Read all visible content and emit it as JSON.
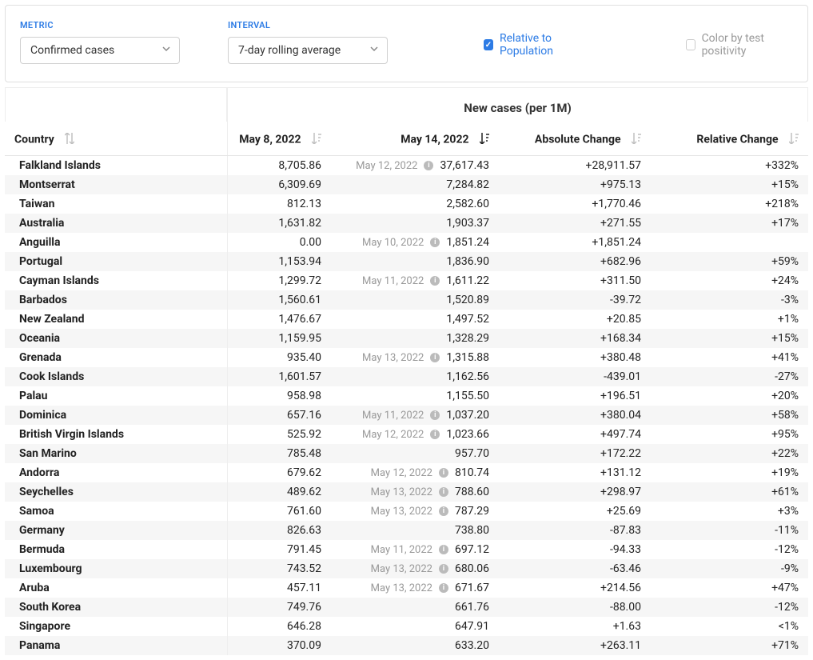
{
  "controls": {
    "metric_label": "METRIC",
    "metric_value": "Confirmed cases",
    "interval_label": "INTERVAL",
    "interval_value": "7-day rolling average",
    "relative_label": "Relative to Population",
    "relative_checked": true,
    "color_label": "Color by test positivity",
    "color_checked": false
  },
  "table": {
    "title": "New cases (per 1M)",
    "headers": {
      "country": "Country",
      "may8": "May 8, 2022",
      "may14": "May 14, 2022",
      "abs": "Absolute Change",
      "rel": "Relative Change"
    },
    "rows": [
      {
        "country": "Falkland Islands",
        "may8": "8,705.86",
        "may14": "37,617.43",
        "note_date": "May 12, 2022",
        "abs": "+28,911.57",
        "rel": "+332%"
      },
      {
        "country": "Montserrat",
        "may8": "6,309.69",
        "may14": "7,284.82",
        "note_date": null,
        "abs": "+975.13",
        "rel": "+15%"
      },
      {
        "country": "Taiwan",
        "may8": "812.13",
        "may14": "2,582.60",
        "note_date": null,
        "abs": "+1,770.46",
        "rel": "+218%"
      },
      {
        "country": "Australia",
        "may8": "1,631.82",
        "may14": "1,903.37",
        "note_date": null,
        "abs": "+271.55",
        "rel": "+17%"
      },
      {
        "country": "Anguilla",
        "may8": "0.00",
        "may14": "1,851.24",
        "note_date": "May 10, 2022",
        "abs": "+1,851.24",
        "rel": ""
      },
      {
        "country": "Portugal",
        "may8": "1,153.94",
        "may14": "1,836.90",
        "note_date": null,
        "abs": "+682.96",
        "rel": "+59%"
      },
      {
        "country": "Cayman Islands",
        "may8": "1,299.72",
        "may14": "1,611.22",
        "note_date": "May 11, 2022",
        "abs": "+311.50",
        "rel": "+24%"
      },
      {
        "country": "Barbados",
        "may8": "1,560.61",
        "may14": "1,520.89",
        "note_date": null,
        "abs": "-39.72",
        "rel": "-3%"
      },
      {
        "country": "New Zealand",
        "may8": "1,476.67",
        "may14": "1,497.52",
        "note_date": null,
        "abs": "+20.85",
        "rel": "+1%"
      },
      {
        "country": "Oceania",
        "may8": "1,159.95",
        "may14": "1,328.29",
        "note_date": null,
        "abs": "+168.34",
        "rel": "+15%"
      },
      {
        "country": "Grenada",
        "may8": "935.40",
        "may14": "1,315.88",
        "note_date": "May 13, 2022",
        "abs": "+380.48",
        "rel": "+41%"
      },
      {
        "country": "Cook Islands",
        "may8": "1,601.57",
        "may14": "1,162.56",
        "note_date": null,
        "abs": "-439.01",
        "rel": "-27%"
      },
      {
        "country": "Palau",
        "may8": "958.98",
        "may14": "1,155.50",
        "note_date": null,
        "abs": "+196.51",
        "rel": "+20%"
      },
      {
        "country": "Dominica",
        "may8": "657.16",
        "may14": "1,037.20",
        "note_date": "May 11, 2022",
        "abs": "+380.04",
        "rel": "+58%"
      },
      {
        "country": "British Virgin Islands",
        "may8": "525.92",
        "may14": "1,023.66",
        "note_date": "May 12, 2022",
        "abs": "+497.74",
        "rel": "+95%"
      },
      {
        "country": "San Marino",
        "may8": "785.48",
        "may14": "957.70",
        "note_date": null,
        "abs": "+172.22",
        "rel": "+22%"
      },
      {
        "country": "Andorra",
        "may8": "679.62",
        "may14": "810.74",
        "note_date": "May 12, 2022",
        "abs": "+131.12",
        "rel": "+19%"
      },
      {
        "country": "Seychelles",
        "may8": "489.62",
        "may14": "788.60",
        "note_date": "May 13, 2022",
        "abs": "+298.97",
        "rel": "+61%"
      },
      {
        "country": "Samoa",
        "may8": "761.60",
        "may14": "787.29",
        "note_date": "May 13, 2022",
        "abs": "+25.69",
        "rel": "+3%"
      },
      {
        "country": "Germany",
        "may8": "826.63",
        "may14": "738.80",
        "note_date": null,
        "abs": "-87.83",
        "rel": "-11%"
      },
      {
        "country": "Bermuda",
        "may8": "791.45",
        "may14": "697.12",
        "note_date": "May 11, 2022",
        "abs": "-94.33",
        "rel": "-12%"
      },
      {
        "country": "Luxembourg",
        "may8": "743.52",
        "may14": "680.06",
        "note_date": "May 13, 2022",
        "abs": "-63.46",
        "rel": "-9%"
      },
      {
        "country": "Aruba",
        "may8": "457.11",
        "may14": "671.67",
        "note_date": "May 13, 2022",
        "abs": "+214.56",
        "rel": "+47%"
      },
      {
        "country": "South Korea",
        "may8": "749.76",
        "may14": "661.76",
        "note_date": null,
        "abs": "-88.00",
        "rel": "-12%"
      },
      {
        "country": "Singapore",
        "may8": "646.28",
        "may14": "647.91",
        "note_date": null,
        "abs": "+1.63",
        "rel": "<1%"
      },
      {
        "country": "Panama",
        "may8": "370.09",
        "may14": "633.20",
        "note_date": null,
        "abs": "+263.11",
        "rel": "+71%"
      }
    ]
  }
}
